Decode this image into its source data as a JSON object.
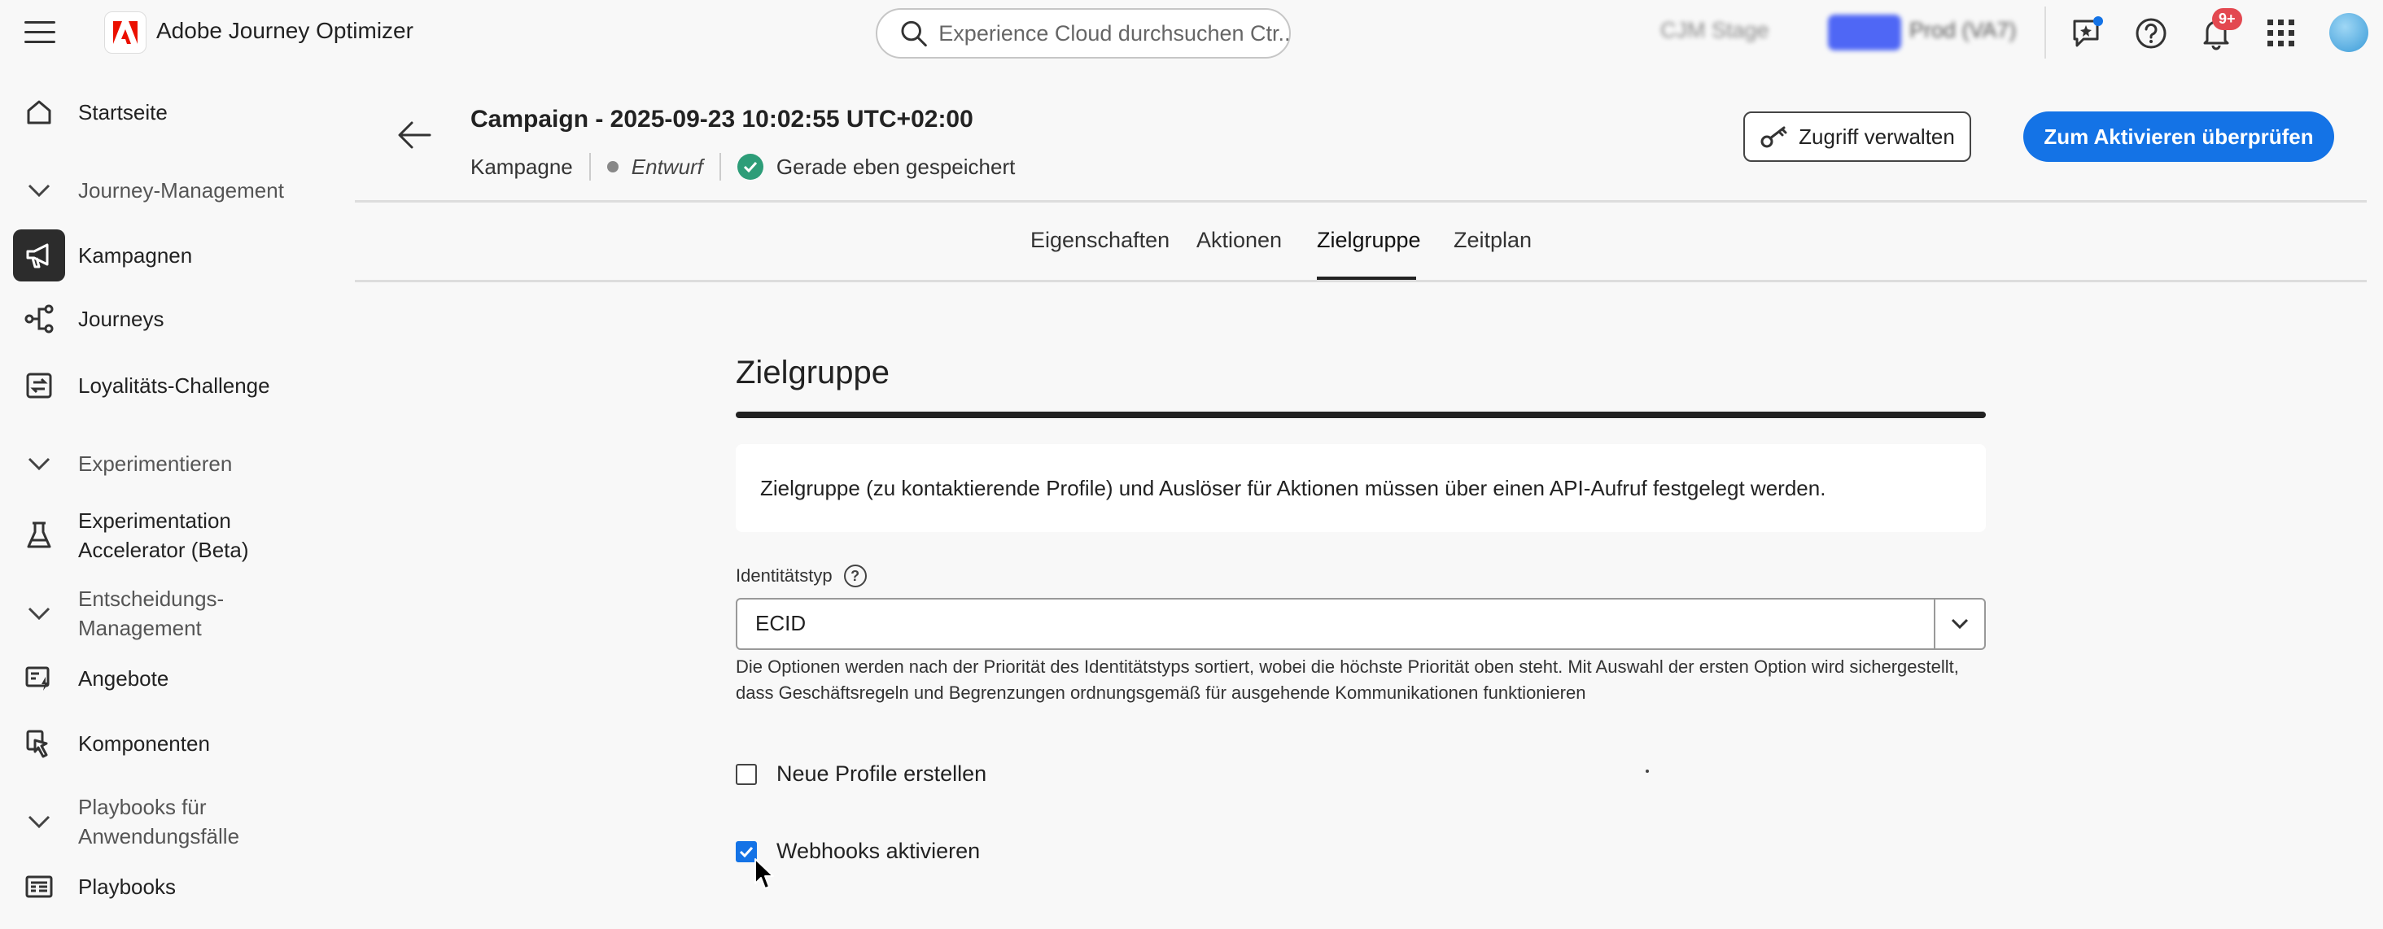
{
  "topbar": {
    "app_name": "Adobe Journey Optimizer",
    "search_placeholder": "Experience Cloud durchsuchen Ctr...",
    "env_sandbox": "CJM Stage",
    "env_badge": "Prod",
    "env_org": "Prod (VA7)",
    "notifications_badge": "9+"
  },
  "sidebar": {
    "items": [
      {
        "label": "Startseite"
      },
      {
        "label": "Journey-Management"
      },
      {
        "label": "Kampagnen"
      },
      {
        "label": "Journeys"
      },
      {
        "label": "Loyalitäts-Challenge"
      },
      {
        "label": "Experimentieren"
      },
      {
        "label_line1": "Experimentation",
        "label_line2": "Accelerator (Beta)"
      },
      {
        "label_line1": "Entscheidungs-",
        "label_line2": "Management"
      },
      {
        "label": "Angebote"
      },
      {
        "label": "Komponenten"
      },
      {
        "label_line1": "Playbooks für",
        "label_line2": "Anwendungsfälle"
      },
      {
        "label": "Playbooks"
      }
    ]
  },
  "header": {
    "title": "Campaign - 2025-09-23 10:02:55 UTC+02:00",
    "type": "Kampagne",
    "status": "Entwurf",
    "saved": "Gerade eben gespeichert",
    "manage_access": "Zugriff verwalten",
    "review_activate": "Zum Aktivieren überprüfen"
  },
  "tabs": [
    {
      "label": "Eigenschaften"
    },
    {
      "label": "Aktionen"
    },
    {
      "label": "Zielgruppe"
    },
    {
      "label": "Zeitplan"
    }
  ],
  "content": {
    "heading": "Zielgruppe",
    "info": "Zielgruppe (zu kontaktierende Profile) und Auslöser für Aktionen müssen über einen API-Aufruf festgelegt werden.",
    "identity_label": "Identitätstyp",
    "identity_value": "ECID",
    "identity_help_line1": "Die Optionen werden nach der Priorität des Identitätstyps sortiert, wobei die höchste Priorität oben steht. Mit Auswahl der ersten Option wird sichergestellt,",
    "identity_help_line2": "dass Geschäftsregeln und Begrenzungen ordnungsgemäß für ausgehende Kommunikationen funktionieren",
    "create_profiles_label": "Neue Profile erstellen",
    "create_profiles_checked": false,
    "webhooks_label": "Webhooks aktivieren",
    "webhooks_checked": true
  },
  "colors": {
    "accent": "#1473e6",
    "success": "#2d9d78",
    "brand_red": "#eb1000"
  }
}
